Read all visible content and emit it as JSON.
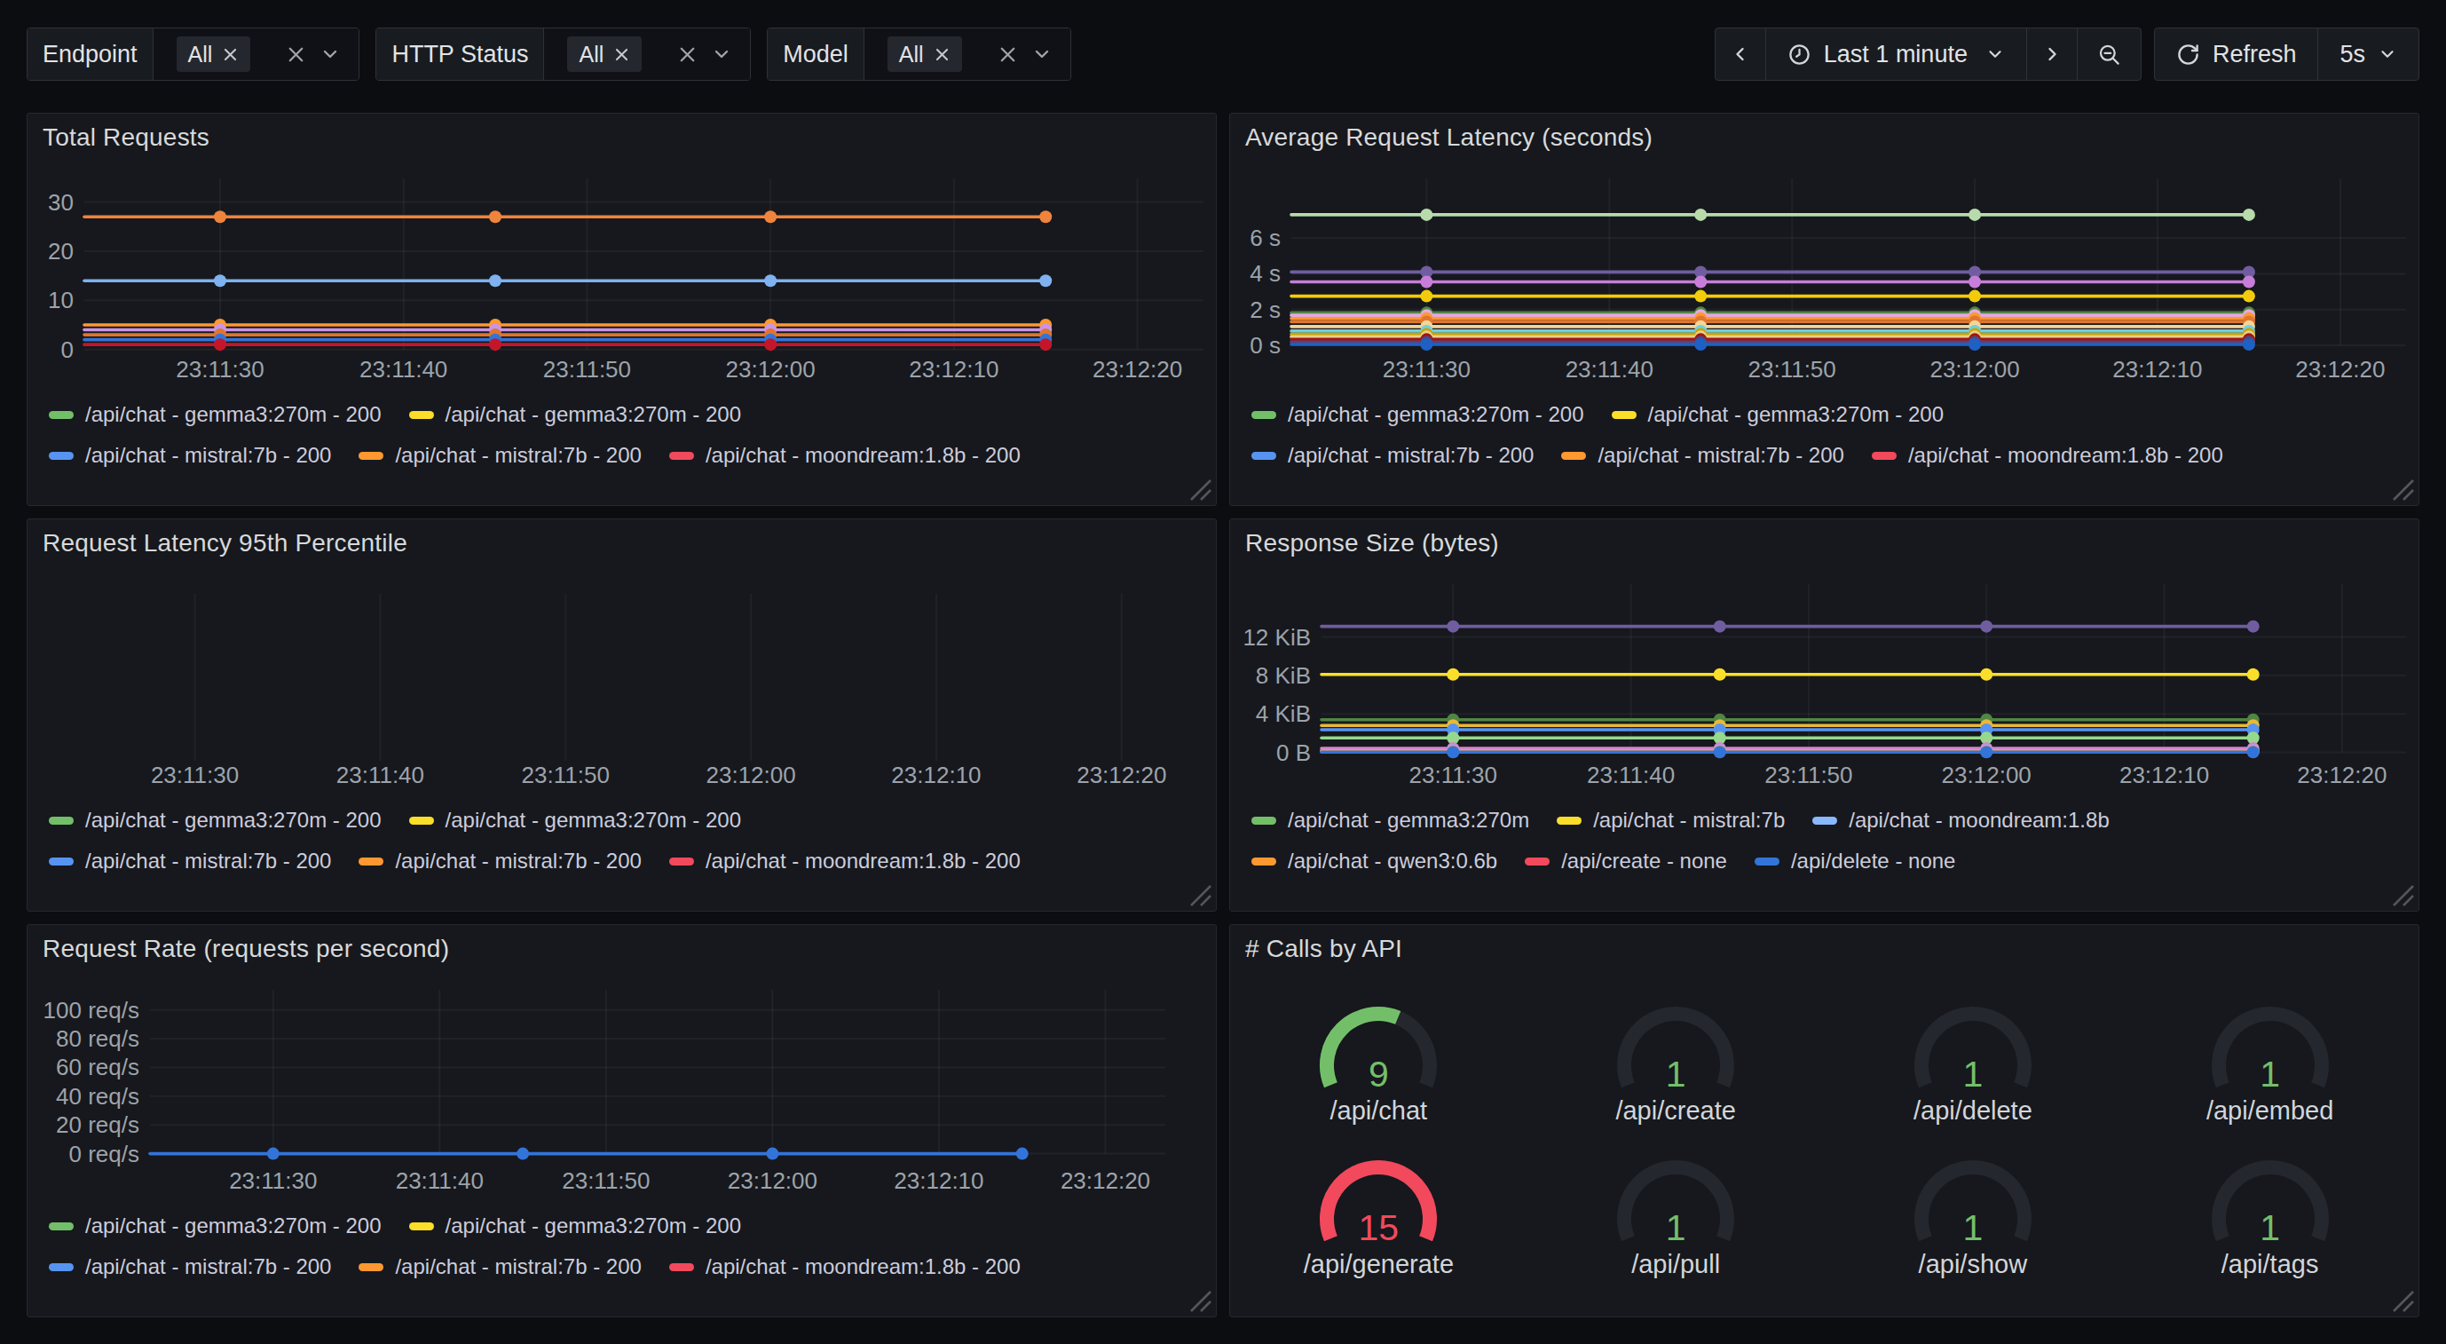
{
  "toolbar": {
    "variables": [
      {
        "label": "Endpoint",
        "selected": "All"
      },
      {
        "label": "HTTP Status",
        "selected": "All"
      },
      {
        "label": "Model",
        "selected": "All"
      }
    ],
    "time_picker": {
      "range_label": "Last 1 minute",
      "refresh_label": "Refresh",
      "refresh_interval": "5s"
    }
  },
  "chart_data": [
    {
      "id": "total-requests",
      "type": "line",
      "title": "Total Requests",
      "xlabel": "",
      "ylabel": "",
      "grid": true,
      "legend_position": "bottom",
      "x_domain_seconds": [
        22.6,
        83.6
      ],
      "x_tick_seconds": [
        30,
        40,
        50,
        60,
        70,
        80
      ],
      "x_tick_labels": [
        "23:11:30",
        "23:11:40",
        "23:11:50",
        "23:12:00",
        "23:12:10",
        "23:12:20"
      ],
      "point_seconds": [
        30,
        45,
        60,
        75
      ],
      "ylim": [
        0,
        34.8
      ],
      "y_ticks": [
        {
          "value": 0,
          "label": "0"
        },
        {
          "value": 10,
          "label": "10"
        },
        {
          "value": 20,
          "label": "20"
        },
        {
          "value": 30,
          "label": "30"
        }
      ],
      "series": [
        {
          "value": 27,
          "color": "#EF843C"
        },
        {
          "value": 14,
          "color": "#7EB2F0"
        },
        {
          "value": 5,
          "color": "#FF9830"
        },
        {
          "value": 4,
          "color": "#CA95E5"
        },
        {
          "value": 3,
          "color": "#E0752D"
        },
        {
          "value": 2,
          "color": "#3274D9"
        },
        {
          "value": 1,
          "color": "#C4162A"
        }
      ],
      "legend_rows": [
        [
          {
            "color": "#73BF69",
            "label": "/api/chat - gemma3:270m - 200"
          },
          {
            "color": "#FADE2A",
            "label": "/api/chat - gemma3:270m - 200"
          }
        ],
        [
          {
            "color": "#5794F2",
            "label": "/api/chat - mistral:7b - 200"
          },
          {
            "color": "#FF9830",
            "label": "/api/chat - mistral:7b - 200"
          },
          {
            "color": "#F2495C",
            "label": "/api/chat - moondream:1.8b - 200"
          }
        ]
      ]
    },
    {
      "id": "avg-latency",
      "type": "line",
      "title": "Average Request Latency (seconds)",
      "xlabel": "",
      "ylabel": "",
      "grid": true,
      "legend_position": "bottom",
      "x_domain_seconds": [
        22.6,
        83.6
      ],
      "x_tick_seconds": [
        30,
        40,
        50,
        60,
        70,
        80
      ],
      "x_tick_labels": [
        "23:11:30",
        "23:11:40",
        "23:11:50",
        "23:12:00",
        "23:12:10",
        "23:12:20"
      ],
      "point_seconds": [
        30,
        45,
        60,
        75
      ],
      "ylim": [
        0,
        9.33
      ],
      "y_ticks": [
        {
          "value": 0,
          "label": "0 s"
        },
        {
          "value": 2,
          "label": "2 s"
        },
        {
          "value": 4,
          "label": "4 s"
        },
        {
          "value": 6,
          "label": "6 s"
        }
      ],
      "series": [
        {
          "value": 7.3,
          "color": "#B7DBAB"
        },
        {
          "value": 4.1,
          "color": "#705DA0"
        },
        {
          "value": 3.55,
          "color": "#C77ED8"
        },
        {
          "value": 2.75,
          "color": "#F2CC0C"
        },
        {
          "value": 1.82,
          "color": "#508642"
        },
        {
          "value": 1.68,
          "color": "#E5A8E2"
        },
        {
          "value": 1.5,
          "color": "#FF9830"
        },
        {
          "value": 1.32,
          "color": "#E0752D"
        },
        {
          "value": 1.05,
          "color": "#F4D598"
        },
        {
          "value": 0.8,
          "color": "#6ED0E0"
        },
        {
          "value": 0.62,
          "color": "#CCA300"
        },
        {
          "value": 0.48,
          "color": "#EACE8E"
        },
        {
          "value": 0.33,
          "color": "#A3150F"
        },
        {
          "value": 0.18,
          "color": "#584477"
        },
        {
          "value": 0.05,
          "color": "#1F60C4"
        }
      ],
      "legend_rows": [
        [
          {
            "color": "#73BF69",
            "label": "/api/chat - gemma3:270m - 200"
          },
          {
            "color": "#FADE2A",
            "label": "/api/chat - gemma3:270m - 200"
          }
        ],
        [
          {
            "color": "#5794F2",
            "label": "/api/chat - mistral:7b - 200"
          },
          {
            "color": "#FF9830",
            "label": "/api/chat - mistral:7b - 200"
          },
          {
            "color": "#F2495C",
            "label": "/api/chat - moondream:1.8b - 200"
          }
        ]
      ]
    },
    {
      "id": "latency-p95",
      "type": "line",
      "title": "Request Latency 95th Percentile",
      "xlabel": "",
      "ylabel": "",
      "grid": true,
      "legend_position": "bottom",
      "x_domain_seconds": [
        22.6,
        83.6
      ],
      "x_tick_seconds": [
        30,
        40,
        50,
        60,
        70,
        80
      ],
      "x_tick_labels": [
        "23:11:30",
        "23:11:40",
        "23:11:50",
        "23:12:00",
        "23:12:10",
        "23:12:20"
      ],
      "point_seconds": [],
      "ylim": [
        0,
        1
      ],
      "y_ticks": [],
      "series": [],
      "legend_rows": [
        [
          {
            "color": "#73BF69",
            "label": "/api/chat - gemma3:270m - 200"
          },
          {
            "color": "#FADE2A",
            "label": "/api/chat - gemma3:270m - 200"
          }
        ],
        [
          {
            "color": "#5794F2",
            "label": "/api/chat - mistral:7b - 200"
          },
          {
            "color": "#FF9830",
            "label": "/api/chat - mistral:7b - 200"
          },
          {
            "color": "#F2495C",
            "label": "/api/chat - moondream:1.8b - 200"
          }
        ]
      ]
    },
    {
      "id": "response-size",
      "type": "line",
      "title": "Response Size (bytes)",
      "xlabel": "",
      "ylabel": "",
      "grid": true,
      "legend_position": "bottom",
      "x_domain_seconds": [
        22.6,
        83.6
      ],
      "x_tick_seconds": [
        30,
        40,
        50,
        60,
        70,
        80
      ],
      "x_tick_labels": [
        "23:11:30",
        "23:11:40",
        "23:11:50",
        "23:12:00",
        "23:12:10",
        "23:12:20"
      ],
      "point_seconds": [
        30,
        45,
        60,
        75
      ],
      "ylim": [
        0,
        17.5
      ],
      "y_unit": "KiB",
      "y_ticks": [
        {
          "value": 0,
          "label": "0 B"
        },
        {
          "value": 4,
          "label": "4 KiB"
        },
        {
          "value": 8,
          "label": "8 KiB"
        },
        {
          "value": 12,
          "label": "12 KiB"
        }
      ],
      "series": [
        {
          "value": 13.1,
          "color": "#705DA0"
        },
        {
          "value": 8.1,
          "color": "#FADE2A"
        },
        {
          "value": 3.4,
          "color": "#508642"
        },
        {
          "value": 2.8,
          "color": "#EAB839"
        },
        {
          "value": 2.35,
          "color": "#5794F2"
        },
        {
          "value": 1.5,
          "color": "#96D98D"
        },
        {
          "value": 0.42,
          "color": "#D683CE"
        },
        {
          "value": 0.16,
          "color": "#8AB8FF"
        },
        {
          "value": 0.08,
          "color": "#FF9830"
        },
        {
          "value": 0.02,
          "color": "#3274D9"
        }
      ],
      "legend_rows": [
        [
          {
            "color": "#73BF69",
            "label": "/api/chat - gemma3:270m"
          },
          {
            "color": "#FADE2A",
            "label": "/api/chat - mistral:7b"
          },
          {
            "color": "#8AB8FF",
            "label": "/api/chat - moondream:1.8b"
          }
        ],
        [
          {
            "color": "#FF9830",
            "label": "/api/chat - qwen3:0.6b"
          },
          {
            "color": "#F2495C",
            "label": "/api/create - none"
          },
          {
            "color": "#3274D9",
            "label": "/api/delete - none"
          }
        ]
      ]
    },
    {
      "id": "request-rate",
      "type": "line",
      "title": "Request Rate (requests per second)",
      "xlabel": "",
      "ylabel": "",
      "grid": true,
      "legend_position": "bottom",
      "x_domain_seconds": [
        22.6,
        83.6
      ],
      "x_tick_seconds": [
        30,
        40,
        50,
        60,
        70,
        80
      ],
      "x_tick_labels": [
        "23:11:30",
        "23:11:40",
        "23:11:50",
        "23:12:00",
        "23:12:10",
        "23:12:20"
      ],
      "point_seconds": [
        30,
        45,
        60,
        75
      ],
      "ylim": [
        0,
        114
      ],
      "y_ticks": [
        {
          "value": 0,
          "label": "0 req/s"
        },
        {
          "value": 20,
          "label": "20 req/s"
        },
        {
          "value": 40,
          "label": "40 req/s"
        },
        {
          "value": 60,
          "label": "60 req/s"
        },
        {
          "value": 80,
          "label": "80 req/s"
        },
        {
          "value": 100,
          "label": "100 req/s"
        }
      ],
      "series": [
        {
          "value": 0,
          "color": "#3274D9"
        }
      ],
      "legend_rows": [
        [
          {
            "color": "#73BF69",
            "label": "/api/chat - gemma3:270m - 200"
          },
          {
            "color": "#FADE2A",
            "label": "/api/chat - gemma3:270m - 200"
          }
        ],
        [
          {
            "color": "#5794F2",
            "label": "/api/chat - mistral:7b - 200"
          },
          {
            "color": "#FF9830",
            "label": "/api/chat - mistral:7b - 200"
          },
          {
            "color": "#F2495C",
            "label": "/api/chat - moondream:1.8b - 200"
          }
        ]
      ]
    },
    {
      "id": "calls-by-api",
      "type": "gauge",
      "title": "# Calls by API",
      "min": 0,
      "max": 15,
      "gauges": [
        {
          "label": "/api/chat",
          "value": 9,
          "color": "#73BF69"
        },
        {
          "label": "/api/create",
          "value": 1,
          "color": "#73BF69"
        },
        {
          "label": "/api/delete",
          "value": 1,
          "color": "#73BF69"
        },
        {
          "label": "/api/embed",
          "value": 1,
          "color": "#73BF69"
        },
        {
          "label": "/api/generate",
          "value": 15,
          "color": "#F2495C"
        },
        {
          "label": "/api/pull",
          "value": 1,
          "color": "#73BF69"
        },
        {
          "label": "/api/show",
          "value": 1,
          "color": "#73BF69"
        },
        {
          "label": "/api/tags",
          "value": 1,
          "color": "#73BF69"
        }
      ]
    }
  ]
}
